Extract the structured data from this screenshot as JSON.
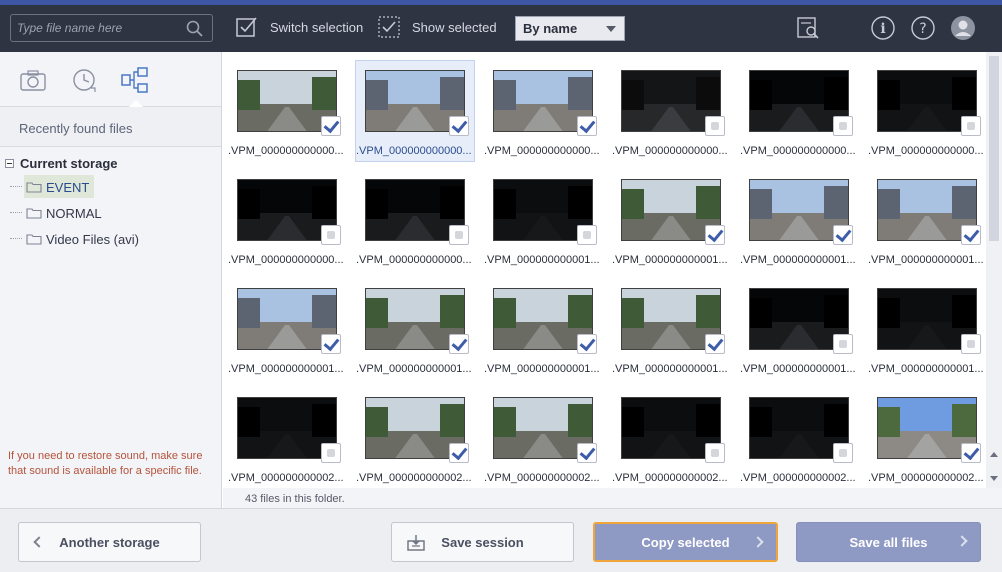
{
  "colors": {
    "toolbar_bg": "#2f3443",
    "accent": "#3d57a4",
    "primary_button": "#8f9ac4",
    "focus_border": "#f0a53a",
    "hint_text": "#b5533b"
  },
  "toolbar": {
    "search_placeholder": "Type file name here",
    "switch_selection_label": "Switch selection",
    "show_selected_label": "Show selected",
    "sort_value": "By name",
    "icons": [
      "search-icon",
      "preview-search-icon",
      "info-icon",
      "help-icon",
      "user-avatar-icon"
    ]
  },
  "sidebar": {
    "tabs": [
      {
        "icon": "camera-icon"
      },
      {
        "icon": "clock-icon"
      },
      {
        "icon": "tree-view-icon",
        "active": true
      }
    ],
    "recent_label": "Recently found files",
    "tree_root": "Current storage",
    "folders": [
      {
        "label": "EVENT",
        "selected": true
      },
      {
        "label": "NORMAL",
        "selected": false
      },
      {
        "label": "Video Files (avi)",
        "selected": false
      }
    ],
    "hint": "If you need to restore sound, make sure that sound is available for a specific file."
  },
  "files": [
    {
      "name": ".VPM_000000000000...",
      "checked": true,
      "selected": false,
      "scene": "day"
    },
    {
      "name": ".VPM_000000000000...",
      "checked": true,
      "selected": true,
      "scene": "city"
    },
    {
      "name": ".VPM_000000000000...",
      "checked": true,
      "selected": false,
      "scene": "city"
    },
    {
      "name": ".VPM_000000000000...",
      "checked": false,
      "selected": false,
      "scene": "garage"
    },
    {
      "name": ".VPM_000000000000...",
      "checked": false,
      "selected": false,
      "scene": "night"
    },
    {
      "name": ".VPM_000000000000...",
      "checked": false,
      "selected": false,
      "scene": "dark"
    },
    {
      "name": ".VPM_000000000000...",
      "checked": false,
      "selected": false,
      "scene": "night"
    },
    {
      "name": ".VPM_000000000000...",
      "checked": false,
      "selected": false,
      "scene": "night"
    },
    {
      "name": ".VPM_000000000001...",
      "checked": false,
      "selected": false,
      "scene": "dark"
    },
    {
      "name": ".VPM_000000000001...",
      "checked": true,
      "selected": false,
      "scene": "day"
    },
    {
      "name": ".VPM_000000000001...",
      "checked": true,
      "selected": false,
      "scene": "city"
    },
    {
      "name": ".VPM_000000000001...",
      "checked": true,
      "selected": false,
      "scene": "city"
    },
    {
      "name": ".VPM_000000000001...",
      "checked": true,
      "selected": false,
      "scene": "city"
    },
    {
      "name": ".VPM_000000000001...",
      "checked": true,
      "selected": false,
      "scene": "day"
    },
    {
      "name": ".VPM_000000000001...",
      "checked": true,
      "selected": false,
      "scene": "day"
    },
    {
      "name": ".VPM_000000000001...",
      "checked": true,
      "selected": false,
      "scene": "day"
    },
    {
      "name": ".VPM_000000000001...",
      "checked": false,
      "selected": false,
      "scene": "night"
    },
    {
      "name": ".VPM_000000000001...",
      "checked": false,
      "selected": false,
      "scene": "dark"
    },
    {
      "name": ".VPM_000000000002...",
      "checked": false,
      "selected": false,
      "scene": "dark"
    },
    {
      "name": ".VPM_000000000002...",
      "checked": true,
      "selected": false,
      "scene": "day"
    },
    {
      "name": ".VPM_000000000002...",
      "checked": true,
      "selected": false,
      "scene": "day"
    },
    {
      "name": ".VPM_000000000002...",
      "checked": false,
      "selected": false,
      "scene": "dark"
    },
    {
      "name": ".VPM_000000000002...",
      "checked": false,
      "selected": false,
      "scene": "dark"
    },
    {
      "name": ".VPM_000000000002...",
      "checked": true,
      "selected": false,
      "scene": "sky"
    }
  ],
  "status": "43 files in this folder.",
  "buttons": {
    "another_storage": "Another storage",
    "save_session": "Save session",
    "copy_selected": "Copy selected",
    "save_all": "Save all files"
  }
}
